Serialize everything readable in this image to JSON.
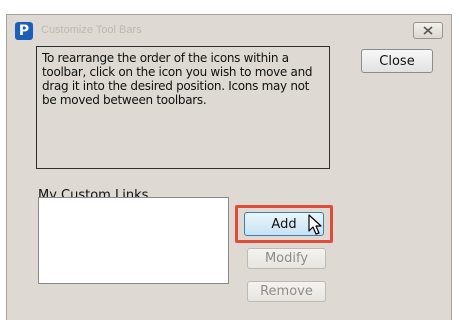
{
  "dialog": {
    "title": "Customize Tool Bars",
    "app_icon_letter": "P",
    "instructions": "To rearrange the order of the icons within a toolbar, click on the icon you wish to move and drag it into the desired position. Icons may not be moved between toolbars.",
    "close_label": "Close"
  },
  "custom_links": {
    "label": "My Custom Links",
    "items": [],
    "add_label": "Add",
    "modify_label": "Modify",
    "remove_label": "Remove"
  },
  "colors": {
    "dialog_bg": "#dedad3",
    "app_icon": "#1b5fb8",
    "highlight": "#e04b3a"
  },
  "icons": {
    "window_close": "close-icon",
    "cursor": "mouse-pointer-icon"
  }
}
